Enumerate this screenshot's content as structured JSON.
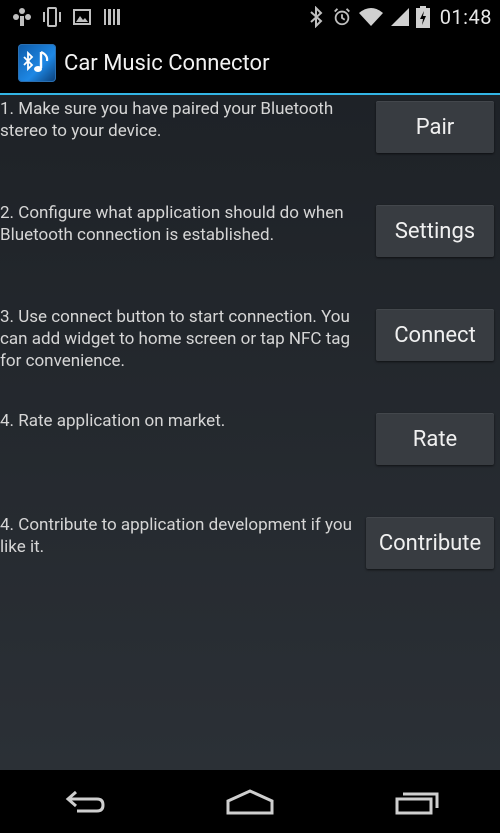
{
  "status_bar": {
    "left_icons": [
      "usb-debug-icon",
      "phone-vibrate-icon",
      "image-icon",
      "barcode-icon"
    ],
    "right_icons": [
      "bluetooth-icon",
      "alarm-icon",
      "wifi-icon",
      "signal-icon",
      "battery-charging-icon"
    ],
    "time": "01:48"
  },
  "action_bar": {
    "title": "Car Music Connector",
    "icon": "bluetooth-music-icon",
    "accent_color": "#33b5e5"
  },
  "steps": [
    {
      "text": "1. Make sure you have paired your Bluetooth stereo to your device.",
      "button": "Pair"
    },
    {
      "text": "2. Configure what application should do when Bluetooth connection is established.",
      "button": "Settings"
    },
    {
      "text": "3. Use connect button to start connection. You can add widget to home screen or tap NFC tag for convenience.",
      "button": "Connect"
    },
    {
      "text": "4. Rate application on market.",
      "button": "Rate"
    },
    {
      "text": "4. Contribute to application development if you like it.",
      "button": "Contribute"
    }
  ],
  "nav_bar": {
    "icons": [
      "back-icon",
      "home-icon",
      "recent-apps-icon"
    ]
  }
}
